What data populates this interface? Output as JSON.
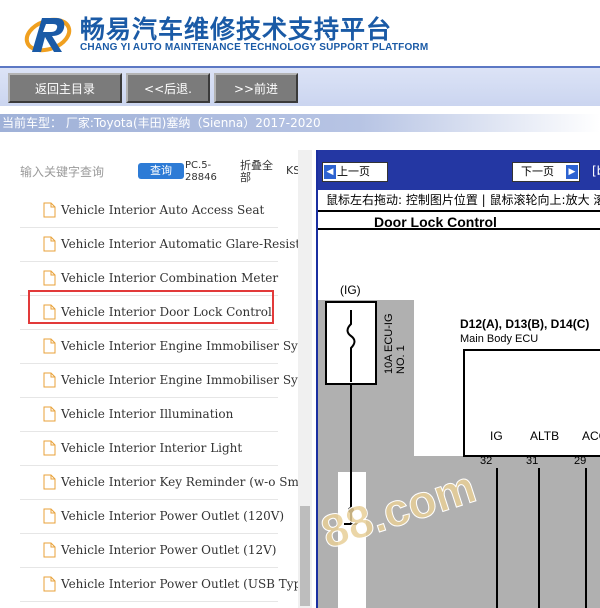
{
  "header": {
    "title": "畅易汽车维修技术支持平台",
    "subtitle": "CHANG YI AUTO MAINTENANCE TECHNOLOGY SUPPORT PLATFORM",
    "brand_color": "#1a5aa6"
  },
  "nav": {
    "main_menu": "返回主目录",
    "back": "<<后退.",
    "forward": ">>前进"
  },
  "vehicle_line": "当前车型： 厂家:Toyota(丰田)塞纳（Sienna）2017-2020",
  "search": {
    "placeholder": "输入关键字查询",
    "button": "查询",
    "pc_code_1": "PC.5-",
    "pc_code_2": "28846",
    "collapse_1": "折叠全",
    "collapse_2": "部",
    "ks": "KS"
  },
  "tree_items": [
    "Vehicle Interior Auto Access Seat",
    "Vehicle Interior Automatic Glare-Resistant EC Mirror",
    "Vehicle Interior Combination Meter",
    "Vehicle Interior Door Lock Control",
    "Vehicle Interior Engine Immobiliser System (w-o Smart Key)",
    "Vehicle Interior Engine Immobiliser System (w Smart Key)",
    "Vehicle Interior Illumination",
    "Vehicle Interior Interior Light",
    "Vehicle Interior Key Reminder (w-o Smart Key)",
    "Vehicle Interior Power Outlet (120V)",
    "Vehicle Interior Power Outlet (12V)",
    "Vehicle Interior Power Outlet (USB Type)"
  ],
  "selected_item": "Vehicle Interior Door Lock Control",
  "diagram": {
    "prev_page": "上一页",
    "next_page": "下一页",
    "bracket": "[b",
    "hint": "鼠标左右拖动: 控制图片位置 | 鼠标滚轮向上:放大 滚",
    "title": "Door Lock Control",
    "fuse_tag": "(IG)",
    "fuse_name_1": "10A ECU-IG",
    "fuse_name_2": "NO. 1",
    "ecu_ids": "D12(A), D13(B), D14(C)",
    "ecu_name": "Main Body ECU",
    "pins": [
      {
        "name": "IG",
        "num": "32"
      },
      {
        "name": "ALTB",
        "num": "31"
      },
      {
        "name": "ACC",
        "num": "29"
      }
    ],
    "watermark": "88.com"
  },
  "colors": {
    "highlight": "#e23a3a",
    "toolbar_blue": "#2437a3",
    "search_button": "#2d7bd6"
  }
}
